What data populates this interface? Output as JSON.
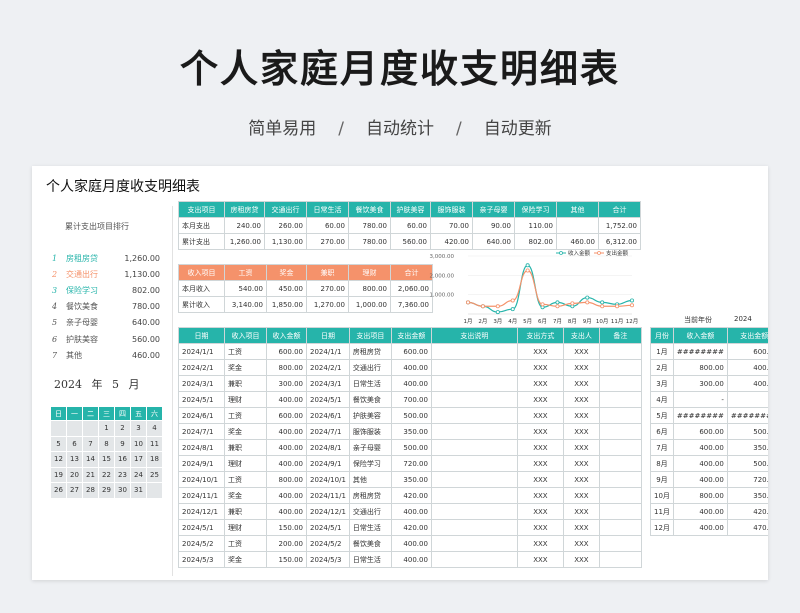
{
  "hero": {
    "title": "个人家庭月度收支明细表",
    "tags": [
      "简单易用",
      "自动统计",
      "自动更新"
    ],
    "sep": "/"
  },
  "sheet_title": "个人家庭月度收支明细表",
  "ranking": {
    "heading": "累计支出项目排行",
    "items": [
      {
        "num": "1",
        "label": "房租房贷",
        "value": "1,260.00",
        "color": "#26b4aa"
      },
      {
        "num": "2",
        "label": "交通出行",
        "value": "1,130.00",
        "color": "#f5926b"
      },
      {
        "num": "3",
        "label": "保险学习",
        "value": "802.00",
        "color": "#26b4aa"
      },
      {
        "num": "4",
        "label": "餐饮美食",
        "value": "780.00",
        "color": "#555555"
      },
      {
        "num": "5",
        "label": "亲子母婴",
        "value": "640.00",
        "color": "#555555"
      },
      {
        "num": "6",
        "label": "护肤美容",
        "value": "560.00",
        "color": "#555555"
      },
      {
        "num": "7",
        "label": "其他",
        "value": "460.00",
        "color": "#555555"
      }
    ]
  },
  "calendar": {
    "year": "2024",
    "year_unit": "年",
    "month": "5",
    "month_unit": "月",
    "weekdays": [
      "日",
      "一",
      "二",
      "三",
      "四",
      "五",
      "六"
    ],
    "weeks": [
      [
        "",
        "",
        "",
        "1",
        "2",
        "3",
        "4"
      ],
      [
        "5",
        "6",
        "7",
        "8",
        "9",
        "10",
        "11"
      ],
      [
        "12",
        "13",
        "14",
        "15",
        "16",
        "17",
        "18"
      ],
      [
        "19",
        "20",
        "21",
        "22",
        "23",
        "24",
        "25"
      ],
      [
        "26",
        "27",
        "28",
        "29",
        "30",
        "31",
        ""
      ]
    ]
  },
  "expense_summary": {
    "headers": [
      "支出项目",
      "房租房贷",
      "交通出行",
      "日常生活",
      "餐饮美食",
      "护肤美容",
      "服饰服装",
      "亲子母婴",
      "保险学习",
      "其他",
      "合计"
    ],
    "rows": [
      [
        "本月支出",
        "240.00",
        "260.00",
        "60.00",
        "780.00",
        "60.00",
        "70.00",
        "90.00",
        "110.00",
        "",
        "1,752.00"
      ],
      [
        "累计支出",
        "1,260.00",
        "1,130.00",
        "270.00",
        "780.00",
        "560.00",
        "420.00",
        "640.00",
        "802.00",
        "460.00",
        "6,312.00"
      ]
    ],
    "widths": [
      46,
      40,
      42,
      42,
      42,
      40,
      42,
      42,
      42,
      42,
      42
    ]
  },
  "income_summary": {
    "headers": [
      "收入项目",
      "工资",
      "奖金",
      "兼职",
      "理财",
      "合计"
    ],
    "rows": [
      [
        "本月收入",
        "540.00",
        "450.00",
        "270.00",
        "800.00",
        "2,060.00"
      ],
      [
        "累计收入",
        "3,140.00",
        "1,850.00",
        "1,270.00",
        "1,000.00",
        "7,360.00"
      ]
    ]
  },
  "chart_data": {
    "type": "line",
    "x": [
      "1月",
      "2月",
      "3月",
      "4月",
      "5月",
      "6月",
      "7月",
      "8月",
      "9月",
      "10月",
      "11月",
      "12月"
    ],
    "ylim": [
      0,
      3000
    ],
    "yticks": [
      "3,000.00",
      "2,000.00",
      "1,000.00"
    ],
    "series": [
      {
        "name": "收入金额",
        "color": "#26b4aa",
        "values": [
          600,
          400,
          100,
          250,
          2520,
          350,
          600,
          400,
          850,
          600,
          500,
          700
        ]
      },
      {
        "name": "支出金额",
        "color": "#f5926b",
        "values": [
          600,
          400,
          400,
          700,
          2250,
          500,
          400,
          550,
          600,
          400,
          400,
          450
        ]
      }
    ]
  },
  "detail": {
    "headers": [
      "日期",
      "收入项目",
      "收入金额",
      "日期",
      "支出项目",
      "支出金额",
      "支出说明",
      "支出方式",
      "支出人",
      "备注"
    ],
    "widths": [
      46,
      42,
      40,
      42,
      42,
      40,
      86,
      46,
      36,
      42
    ],
    "rows": [
      [
        "2024/1/1",
        "工资",
        "600.00",
        "2024/1/1",
        "房租房贷",
        "600.00",
        "",
        "XXX",
        "XXX",
        ""
      ],
      [
        "2024/2/1",
        "奖金",
        "800.00",
        "2024/2/1",
        "交通出行",
        "400.00",
        "",
        "XXX",
        "XXX",
        ""
      ],
      [
        "2024/3/1",
        "兼职",
        "300.00",
        "2024/3/1",
        "日常生活",
        "400.00",
        "",
        "XXX",
        "XXX",
        ""
      ],
      [
        "2024/5/1",
        "理财",
        "400.00",
        "2024/5/1",
        "餐饮美食",
        "700.00",
        "",
        "XXX",
        "XXX",
        ""
      ],
      [
        "2024/6/1",
        "工资",
        "600.00",
        "2024/6/1",
        "护肤美容",
        "500.00",
        "",
        "XXX",
        "XXX",
        ""
      ],
      [
        "2024/7/1",
        "奖金",
        "400.00",
        "2024/7/1",
        "服饰服装",
        "350.00",
        "",
        "XXX",
        "XXX",
        ""
      ],
      [
        "2024/8/1",
        "兼职",
        "400.00",
        "2024/8/1",
        "亲子母婴",
        "500.00",
        "",
        "XXX",
        "XXX",
        ""
      ],
      [
        "2024/9/1",
        "理财",
        "400.00",
        "2024/9/1",
        "保险学习",
        "720.00",
        "",
        "XXX",
        "XXX",
        ""
      ],
      [
        "2024/10/1",
        "工资",
        "800.00",
        "2024/10/1",
        "其他",
        "350.00",
        "",
        "XXX",
        "XXX",
        ""
      ],
      [
        "2024/11/1",
        "奖金",
        "400.00",
        "2024/11/1",
        "房租房贷",
        "420.00",
        "",
        "XXX",
        "XXX",
        ""
      ],
      [
        "2024/12/1",
        "兼职",
        "400.00",
        "2024/12/1",
        "交通出行",
        "400.00",
        "",
        "XXX",
        "XXX",
        ""
      ],
      [
        "2024/5/1",
        "理财",
        "150.00",
        "2024/5/1",
        "日常生活",
        "420.00",
        "",
        "XXX",
        "XXX",
        ""
      ],
      [
        "2024/5/2",
        "工资",
        "200.00",
        "2024/5/2",
        "餐饮美食",
        "400.00",
        "",
        "XXX",
        "XXX",
        ""
      ],
      [
        "2024/5/3",
        "奖金",
        "150.00",
        "2024/5/3",
        "日常生活",
        "400.00",
        "",
        "XXX",
        "XXX",
        ""
      ]
    ]
  },
  "monthly": {
    "label": "当前年份",
    "year": "2024",
    "headers": [
      "月份",
      "收入金额",
      "支出金额"
    ],
    "rows": [
      [
        "1月",
        "########",
        "600.00"
      ],
      [
        "2月",
        "800.00",
        "400.00"
      ],
      [
        "3月",
        "300.00",
        "400.00"
      ],
      [
        "4月",
        "-",
        "-"
      ],
      [
        "5月",
        "########",
        "########"
      ],
      [
        "6月",
        "600.00",
        "500.00"
      ],
      [
        "7月",
        "400.00",
        "350.00"
      ],
      [
        "8月",
        "400.00",
        "500.00"
      ],
      [
        "9月",
        "400.00",
        "720.00"
      ],
      [
        "10月",
        "800.00",
        "350.00"
      ],
      [
        "11月",
        "400.00",
        "420.00"
      ],
      [
        "12月",
        "400.00",
        "470.00"
      ]
    ]
  }
}
